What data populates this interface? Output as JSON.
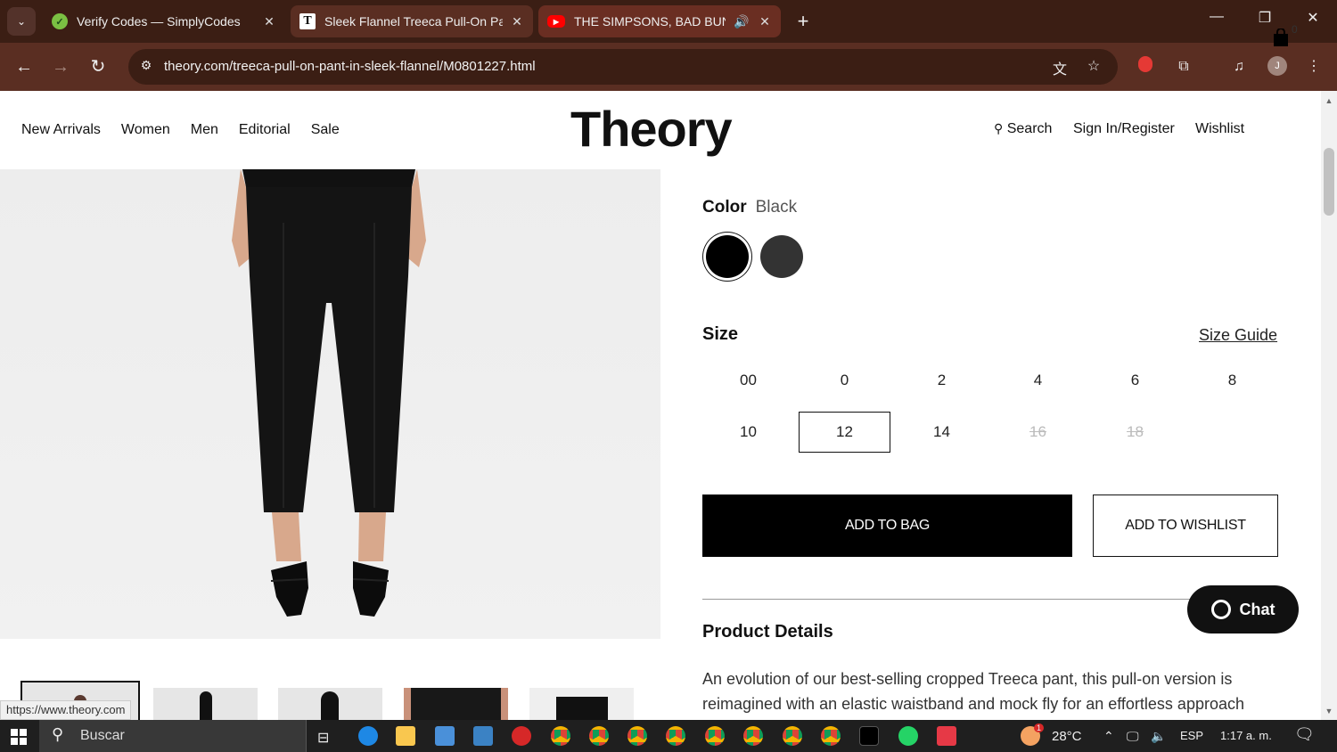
{
  "browser": {
    "tabs": [
      {
        "title": "Verify Codes — SimplyCodes"
      },
      {
        "title": "Sleek Flannel Treeca Pull-On Pa"
      },
      {
        "title": "THE SIMPSONS, BAD BUNN"
      }
    ],
    "url": "theory.com/treeca-pull-on-pant-in-sleek-flannel/M0801227.html",
    "profile_initial": "J"
  },
  "site": {
    "nav": [
      "New Arrivals",
      "Women",
      "Men",
      "Editorial",
      "Sale"
    ],
    "logo": "Theory",
    "search_label": "Search",
    "signin_label": "Sign In/Register",
    "wishlist_label": "Wishlist",
    "bag_count": "0"
  },
  "product": {
    "color_label": "Color",
    "color_value": "Black",
    "size_label": "Size",
    "size_guide": "Size Guide",
    "sizes": [
      {
        "label": "00",
        "available": true
      },
      {
        "label": "0",
        "available": true
      },
      {
        "label": "2",
        "available": true
      },
      {
        "label": "4",
        "available": true
      },
      {
        "label": "6",
        "available": true
      },
      {
        "label": "8",
        "available": true
      },
      {
        "label": "10",
        "available": true
      },
      {
        "label": "12",
        "available": true,
        "selected": true
      },
      {
        "label": "14",
        "available": true
      },
      {
        "label": "16",
        "available": false
      },
      {
        "label": "18",
        "available": false
      }
    ],
    "add_to_bag": "ADD TO BAG",
    "add_to_wishlist": "ADD TO WISHLIST",
    "details_title": "Product Details",
    "details_text": "An evolution of our best-selling cropped Treeca pant, this pull-on version is reimagined with an elastic waistband and mock fly for an effortless approach",
    "chat_label": "Chat"
  },
  "status_bar_url": "https://www.theory.com",
  "taskbar": {
    "search_placeholder": "Buscar",
    "temperature": "28°C",
    "language": "ESP",
    "time": "1:17 a. m.",
    "weather_badge": "1"
  }
}
